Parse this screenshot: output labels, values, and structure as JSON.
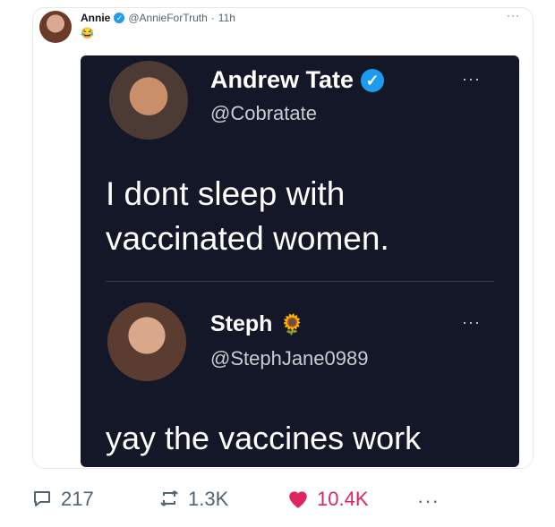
{
  "post": {
    "author": {
      "name": "Annie",
      "handle": "@AnnieForTruth",
      "time": "11h"
    },
    "emoji": "😂",
    "more_label": "···"
  },
  "screenshot": {
    "tweet1": {
      "name": "Andrew Tate",
      "handle": "@Cobratate",
      "text": "I dont sleep with vaccinated women.",
      "more_label": "···"
    },
    "tweet2": {
      "name": "Steph",
      "name_emoji": "🌻",
      "handle": "@StephJane0989",
      "text": "yay the vaccines work",
      "more_label": "···"
    }
  },
  "actions": {
    "replies": "217",
    "reposts": "1.3K",
    "likes": "10.4K",
    "more_label": "···"
  },
  "colors": {
    "accent_blue": "#1d9bf0",
    "like_pink": "#e0245e",
    "dark_bg": "#141728",
    "muted": "#536471"
  },
  "icons": [
    "reply-icon",
    "repost-icon",
    "heart-icon",
    "more-icon",
    "verified-icon"
  ]
}
